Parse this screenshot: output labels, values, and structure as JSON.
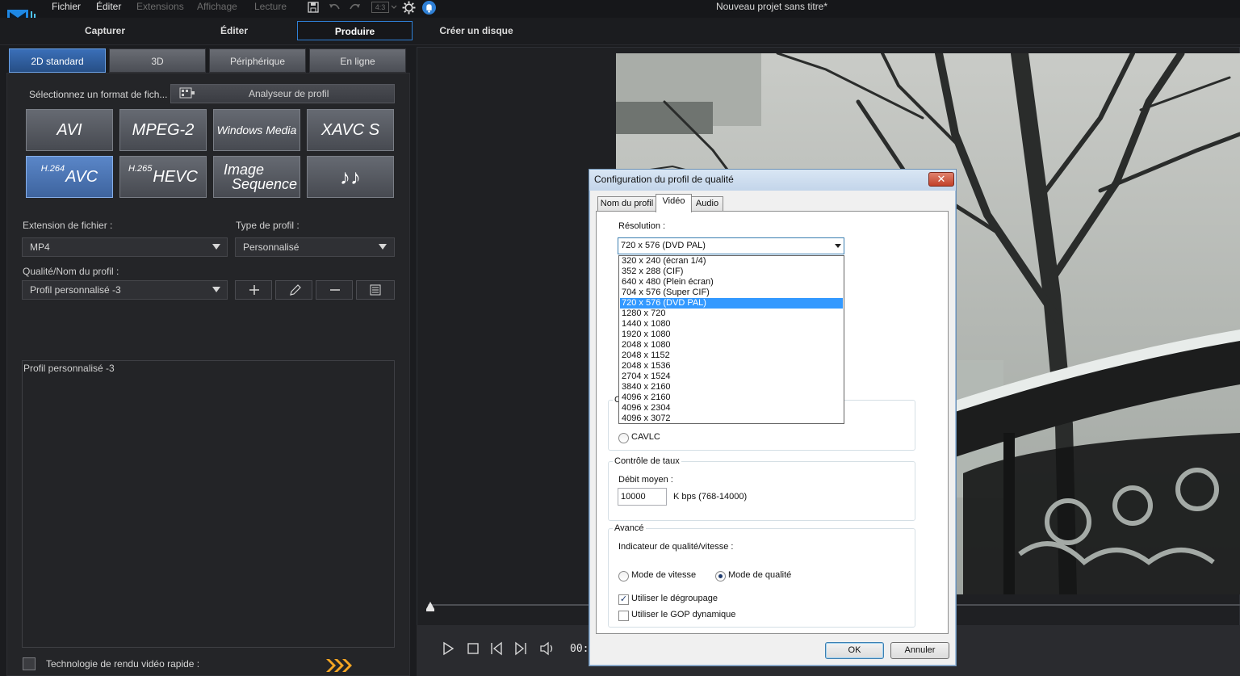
{
  "window": {
    "title": "Nouveau projet sans titre*"
  },
  "menu": {
    "items": [
      "Fichier",
      "Éditer",
      "Extensions",
      "Affichage",
      "Lecture"
    ],
    "aspect_ratio": "4:3"
  },
  "modes": [
    "Capturer",
    "Éditer",
    "Produire",
    "Créer un disque"
  ],
  "subtabs": [
    "2D standard",
    "3D",
    "Périphérique",
    "En ligne"
  ],
  "left": {
    "select_format_label": "Sélectionnez un format de fich...",
    "profile_analyzer": "Analyseur de profil",
    "formats": {
      "avi": "AVI",
      "mpeg2": "MPEG-2",
      "wmv": "Windows Media",
      "xavcs": "XAVC S",
      "avc_sup": "H.264",
      "avc": "AVC",
      "hevc_sup": "H.265",
      "hevc": "HEVC",
      "imgseq_line1": "Image",
      "imgseq_line2": "Sequence",
      "audio": "♪♪"
    },
    "file_ext_label": "Extension de fichier :",
    "file_ext_value": "MP4",
    "profile_type_label": "Type de profil :",
    "profile_type_value": "Personnalisé",
    "quality_label": "Qualité/Nom du profil :",
    "quality_value": "Profil personnalisé -3",
    "description": "Profil personnalisé -3",
    "fast_render_label": "Technologie de rendu vidéo rapide :"
  },
  "transport": {
    "timecode": "00:"
  },
  "dialog": {
    "title": "Configuration du profil de qualité",
    "close": "✕",
    "tabs": [
      "Nom du profil",
      "Vidéo",
      "Audio"
    ],
    "resolution_label": "Résolution :",
    "resolution_value": "720 x 576 (DVD PAL)",
    "resolution_options": [
      "320 x 240 (écran 1/4)",
      "352 x 288 (CIF)",
      "640 x 480 (Plein écran)",
      "704 x 576 (Super CIF)",
      "720 x 576 (DVD PAL)",
      "1280 x 720",
      "1440 x 1080",
      "1920 x 1080",
      "2048 x 1080",
      "2048 x 1152",
      "2048 x 1536",
      "2704 x 1524",
      "3840 x 2160",
      "4096 x 2160",
      "4096 x 2304",
      "4096 x 3072"
    ],
    "selected_option_index": 4,
    "entropy_group_title": "C",
    "cavlc_label": "CAVLC",
    "rate_group_title": "Contrôle de taux",
    "avg_bitrate_label": "Débit moyen :",
    "avg_bitrate_value": "10000",
    "bitrate_unit": "K bps (768-14000)",
    "advanced_group_title": "Avancé",
    "quality_speed_label": "Indicateur de qualité/vitesse :",
    "speed_mode_label": "Mode de vitesse",
    "quality_mode_label": "Mode de qualité",
    "deblocking_label": "Utiliser le dégroupage",
    "dynamic_gop_label": "Utiliser le GOP dynamique",
    "ok": "OK",
    "cancel": "Annuler"
  },
  "colors": {
    "accent": "#2f80d6",
    "selected_option": "#3399ff",
    "panel_bg": "#242528"
  }
}
